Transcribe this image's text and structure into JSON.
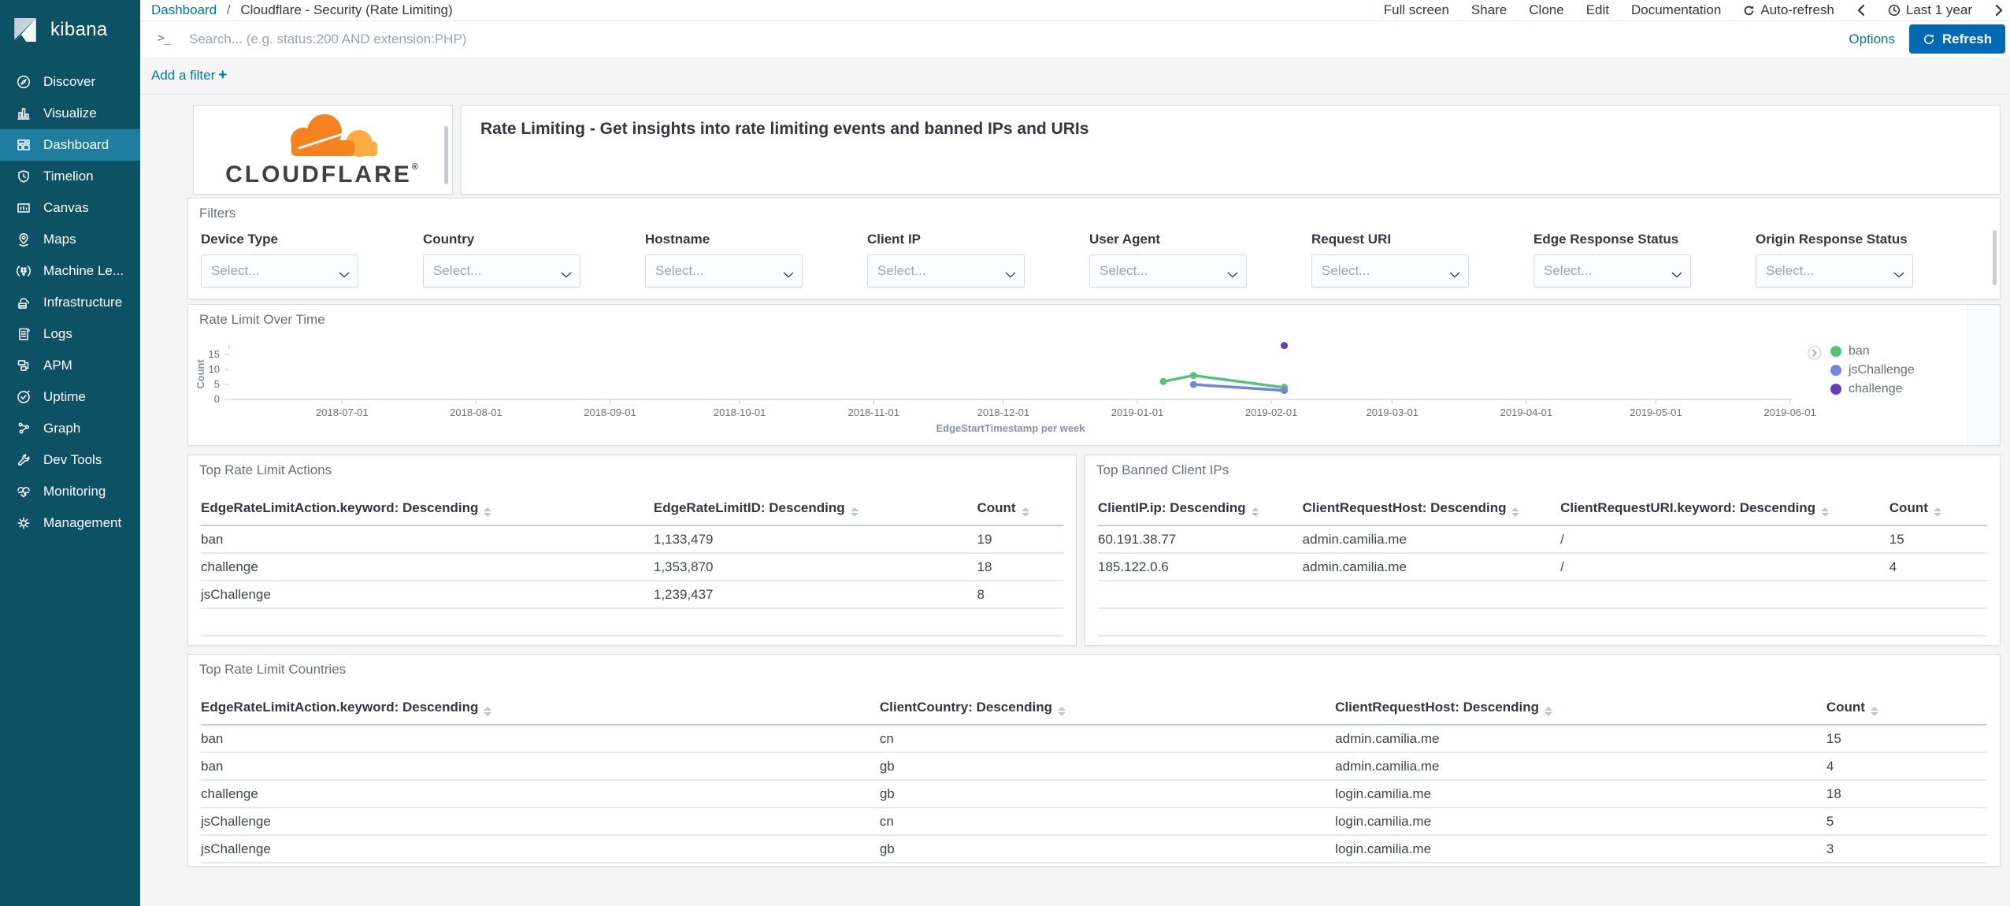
{
  "sidebar": {
    "logo_text": "kibana",
    "items": [
      {
        "id": "discover",
        "label": "Discover",
        "icon": "compass",
        "selected": false
      },
      {
        "id": "visualize",
        "label": "Visualize",
        "icon": "bar-chart",
        "selected": false
      },
      {
        "id": "dashboard",
        "label": "Dashboard",
        "icon": "dashboard",
        "selected": true
      },
      {
        "id": "timelion",
        "label": "Timelion",
        "icon": "shield-clock",
        "selected": false
      },
      {
        "id": "canvas",
        "label": "Canvas",
        "icon": "easel",
        "selected": false
      },
      {
        "id": "maps",
        "label": "Maps",
        "icon": "map-pin",
        "selected": false
      },
      {
        "id": "machine-learning",
        "label": "Machine Le...",
        "icon": "ml-dots",
        "selected": false
      },
      {
        "id": "infrastructure",
        "label": "Infrastructure",
        "icon": "cloud-server",
        "selected": false
      },
      {
        "id": "logs",
        "label": "Logs",
        "icon": "document-lines",
        "selected": false
      },
      {
        "id": "apm",
        "label": "APM",
        "icon": "apm-nodes",
        "selected": false
      },
      {
        "id": "uptime",
        "label": "Uptime",
        "icon": "clock-check",
        "selected": false
      },
      {
        "id": "graph",
        "label": "Graph",
        "icon": "graph-nodes",
        "selected": false
      },
      {
        "id": "dev-tools",
        "label": "Dev Tools",
        "icon": "wrench",
        "selected": false
      },
      {
        "id": "monitoring",
        "label": "Monitoring",
        "icon": "heartbeat",
        "selected": false
      },
      {
        "id": "management",
        "label": "Management",
        "icon": "gear",
        "selected": false
      }
    ]
  },
  "topnav": {
    "breadcrumb": {
      "root": "Dashboard",
      "separator": "/",
      "current": "Cloudflare - Security (Rate Limiting)"
    },
    "actions": [
      {
        "id": "full-screen",
        "label": "Full screen"
      },
      {
        "id": "share",
        "label": "Share"
      },
      {
        "id": "clone",
        "label": "Clone"
      },
      {
        "id": "edit",
        "label": "Edit"
      },
      {
        "id": "documentation",
        "label": "Documentation"
      },
      {
        "id": "auto-refresh",
        "label": "Auto-refresh",
        "icon": "refresh-icon"
      }
    ],
    "time_picker": {
      "label": "Last 1 year"
    }
  },
  "search_bar": {
    "placeholder": "Search... (e.g. status:200 AND extension:PHP)",
    "options_label": "Options",
    "refresh_label": "Refresh"
  },
  "filter_bar": {
    "add_filter_label": "Add a filter"
  },
  "header_panel": {
    "logo_text": "CLOUDFLARE",
    "registered_mark": "®",
    "title": "Rate Limiting - Get insights into rate limiting events and banned IPs and URIs"
  },
  "filters_panel": {
    "title": "Filters",
    "select_placeholder": "Select...",
    "filters": [
      "Device Type",
      "Country",
      "Hostname",
      "Client IP",
      "User Agent",
      "Request URI",
      "Edge Response Status",
      "Origin Response Status"
    ]
  },
  "chart_panel": {
    "title": "Rate Limit Over Time"
  },
  "chart_data": {
    "type": "line",
    "title": "Rate Limit Over Time",
    "xlabel": "EdgeStartTimestamp per week",
    "ylabel": "Count",
    "ylim": [
      0,
      18.5
    ],
    "yticks": [
      0,
      5,
      10,
      15
    ],
    "x_domain": [
      "2018-06-05",
      "2019-06-09"
    ],
    "xticks": [
      "2018-07-01",
      "2018-08-01",
      "2018-09-01",
      "2018-10-01",
      "2018-11-01",
      "2018-12-01",
      "2019-01-01",
      "2019-02-01",
      "2019-03-01",
      "2019-04-01",
      "2019-05-01",
      "2019-06-01"
    ],
    "grid": false,
    "legend_position": "right",
    "series": [
      {
        "name": "ban",
        "color": "#57C17B",
        "points": [
          [
            "2019-01-07",
            6
          ],
          [
            "2019-01-14",
            8
          ],
          [
            "2019-02-04",
            4
          ]
        ]
      },
      {
        "name": "jsChallenge",
        "color": "#6F87D8",
        "points": [
          [
            "2019-01-14",
            5
          ],
          [
            "2019-02-04",
            3
          ]
        ]
      },
      {
        "name": "challenge",
        "color": "#663DB8",
        "points": [
          [
            "2019-02-04",
            18
          ]
        ]
      }
    ]
  },
  "tables": {
    "actions": {
      "title": "Top Rate Limit Actions",
      "columns": [
        "EdgeRateLimitAction.keyword: Descending",
        "EdgeRateLimitID: Descending",
        "Count"
      ],
      "rows": [
        [
          "ban",
          "1,133,479",
          "19"
        ],
        [
          "challenge",
          "1,353,870",
          "18"
        ],
        [
          "jsChallenge",
          "1,239,437",
          "8"
        ]
      ]
    },
    "banned_ips": {
      "title": "Top Banned Client IPs",
      "columns": [
        "ClientIP.ip: Descending",
        "ClientRequestHost: Descending",
        "ClientRequestURI.keyword: Descending",
        "Count"
      ],
      "rows": [
        [
          "60.191.38.77",
          "admin.camilia.me",
          "/",
          "15"
        ],
        [
          "185.122.0.6",
          "admin.camilia.me",
          "/",
          "4"
        ]
      ]
    },
    "countries": {
      "title": "Top Rate Limit Countries",
      "columns": [
        "EdgeRateLimitAction.keyword: Descending",
        "ClientCountry: Descending",
        "ClientRequestHost: Descending",
        "Count"
      ],
      "rows": [
        [
          "ban",
          "cn",
          "admin.camilia.me",
          "15"
        ],
        [
          "ban",
          "gb",
          "admin.camilia.me",
          "4"
        ],
        [
          "challenge",
          "gb",
          "login.camilia.me",
          "18"
        ],
        [
          "jsChallenge",
          "cn",
          "login.camilia.me",
          "5"
        ],
        [
          "jsChallenge",
          "gb",
          "login.camilia.me",
          "3"
        ]
      ]
    }
  },
  "colors": {
    "sidebar_bg": "#0D5165",
    "sidebar_selected": "#1F7EA0",
    "link_blue": "#0079A5",
    "refresh_button_blue": "#006BB4",
    "series_ban_green": "#57C17B",
    "series_jschallenge_blue": "#6F87D8",
    "series_challenge_purple": "#663DB8",
    "cloudflare_orange": "#F6821F",
    "cloudflare_orange_light": "#FBAD41",
    "page_background": "#F5F5F5"
  }
}
